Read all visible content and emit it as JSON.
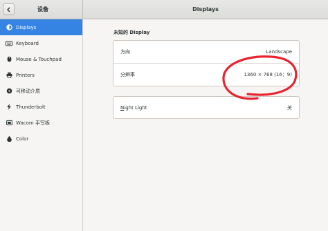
{
  "header": {
    "sidebar_title": "设备",
    "window_title": "Displays"
  },
  "sidebar": {
    "items": [
      {
        "label": "Displays",
        "icon": "display-icon",
        "active": true
      },
      {
        "label": "Keyboard",
        "icon": "keyboard-icon",
        "active": false
      },
      {
        "label": "Mouse & Touchpad",
        "icon": "mouse-icon",
        "active": false
      },
      {
        "label": "Printers",
        "icon": "printer-icon",
        "active": false
      },
      {
        "label": "可移动介质",
        "icon": "removable-media-icon",
        "active": false
      },
      {
        "label": "Thunderbolt",
        "icon": "thunderbolt-icon",
        "active": false
      },
      {
        "label": "Wacom 手写板",
        "icon": "tablet-icon",
        "active": false
      },
      {
        "label": "Color",
        "icon": "color-icon",
        "active": false
      }
    ]
  },
  "main": {
    "display_section_title": "未知的 Display",
    "orientation": {
      "label": "方向",
      "value": "Landscape"
    },
    "resolution": {
      "label": "分辨率",
      "value": "1360 × 768 (16：9)"
    },
    "night_light": {
      "label_mnemonic": "N",
      "label_rest": "ight Light",
      "value": "关"
    }
  },
  "colors": {
    "accent": "#3584e4",
    "annotation": "#e8232d"
  }
}
